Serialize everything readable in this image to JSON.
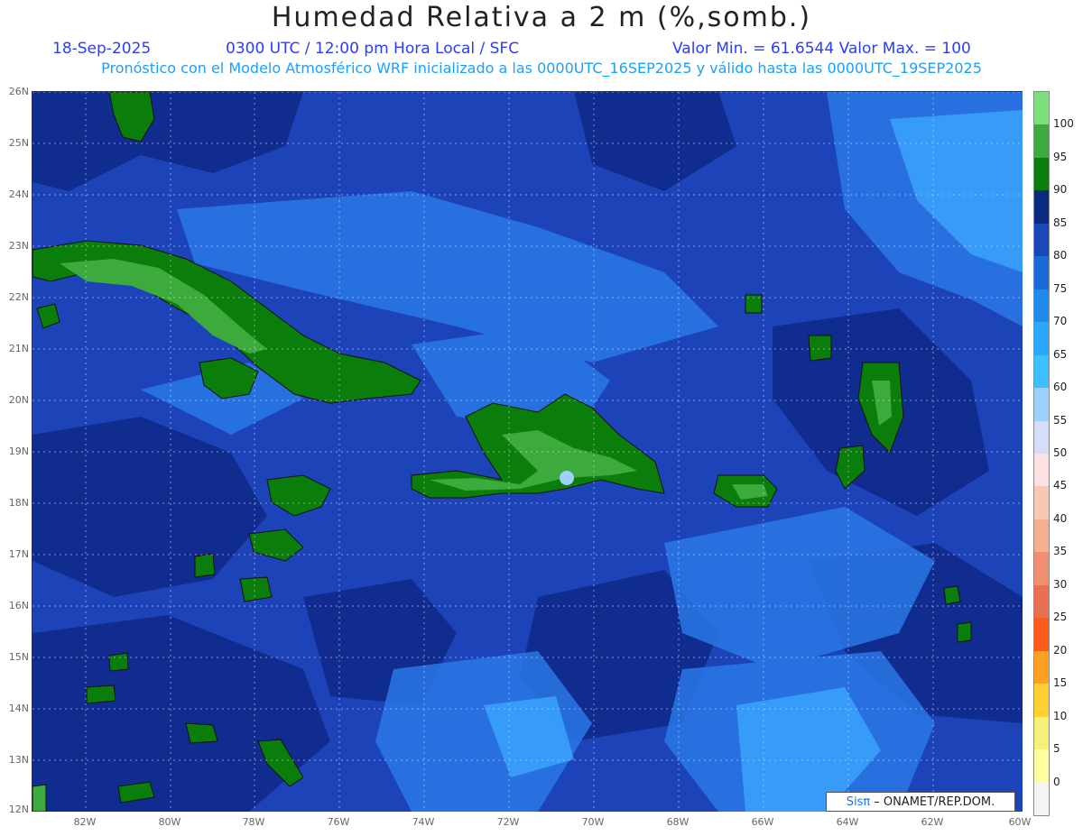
{
  "title": "Humedad Relativa a 2 m (%,somb.)",
  "header": {
    "date": "18-Sep-2025",
    "time": "0300 UTC / 12:00 pm Hora Local / SFC",
    "minmax": "Valor Min. = 61.6544  Valor Max. = 100",
    "model_info": "Pronóstico con el Modelo Atmosférico WRF inicializado a las 0000UTC_16SEP2025 y válido hasta las  0000UTC_19SEP2025"
  },
  "map": {
    "latitudes": [
      "26N",
      "25N",
      "24N",
      "23N",
      "22N",
      "21N",
      "20N",
      "19N",
      "18N",
      "17N",
      "16N",
      "15N",
      "14N",
      "13N",
      "12N"
    ],
    "longitudes": [
      "82W",
      "80W",
      "78W",
      "76W",
      "74W",
      "72W",
      "70W",
      "68W",
      "66W",
      "64W",
      "62W",
      "60W"
    ]
  },
  "colorbar": {
    "labels": [
      "100",
      "95",
      "90",
      "85",
      "80",
      "75",
      "70",
      "65",
      "60",
      "55",
      "50",
      "45",
      "40",
      "35",
      "30",
      "25",
      "20",
      "15",
      "10",
      "5",
      "0"
    ],
    "colors": [
      "#7be07b",
      "#3caa3c",
      "#0a7d0a",
      "#0a2a80",
      "#1a48b8",
      "#1a6adc",
      "#1f8aee",
      "#2aa8ff",
      "#3cc0ff",
      "#9ed0ff",
      "#d6ddf8",
      "#fde0e0",
      "#f8c8b0",
      "#f4b090",
      "#f09070",
      "#e87050",
      "#ff5a1a",
      "#ffa020",
      "#ffd030",
      "#f5f07a",
      "#ffffa0",
      "#f4f4f4"
    ]
  },
  "credit": {
    "logo": "Sisπ",
    "text": "– ONAMET/REP.DOM."
  }
}
